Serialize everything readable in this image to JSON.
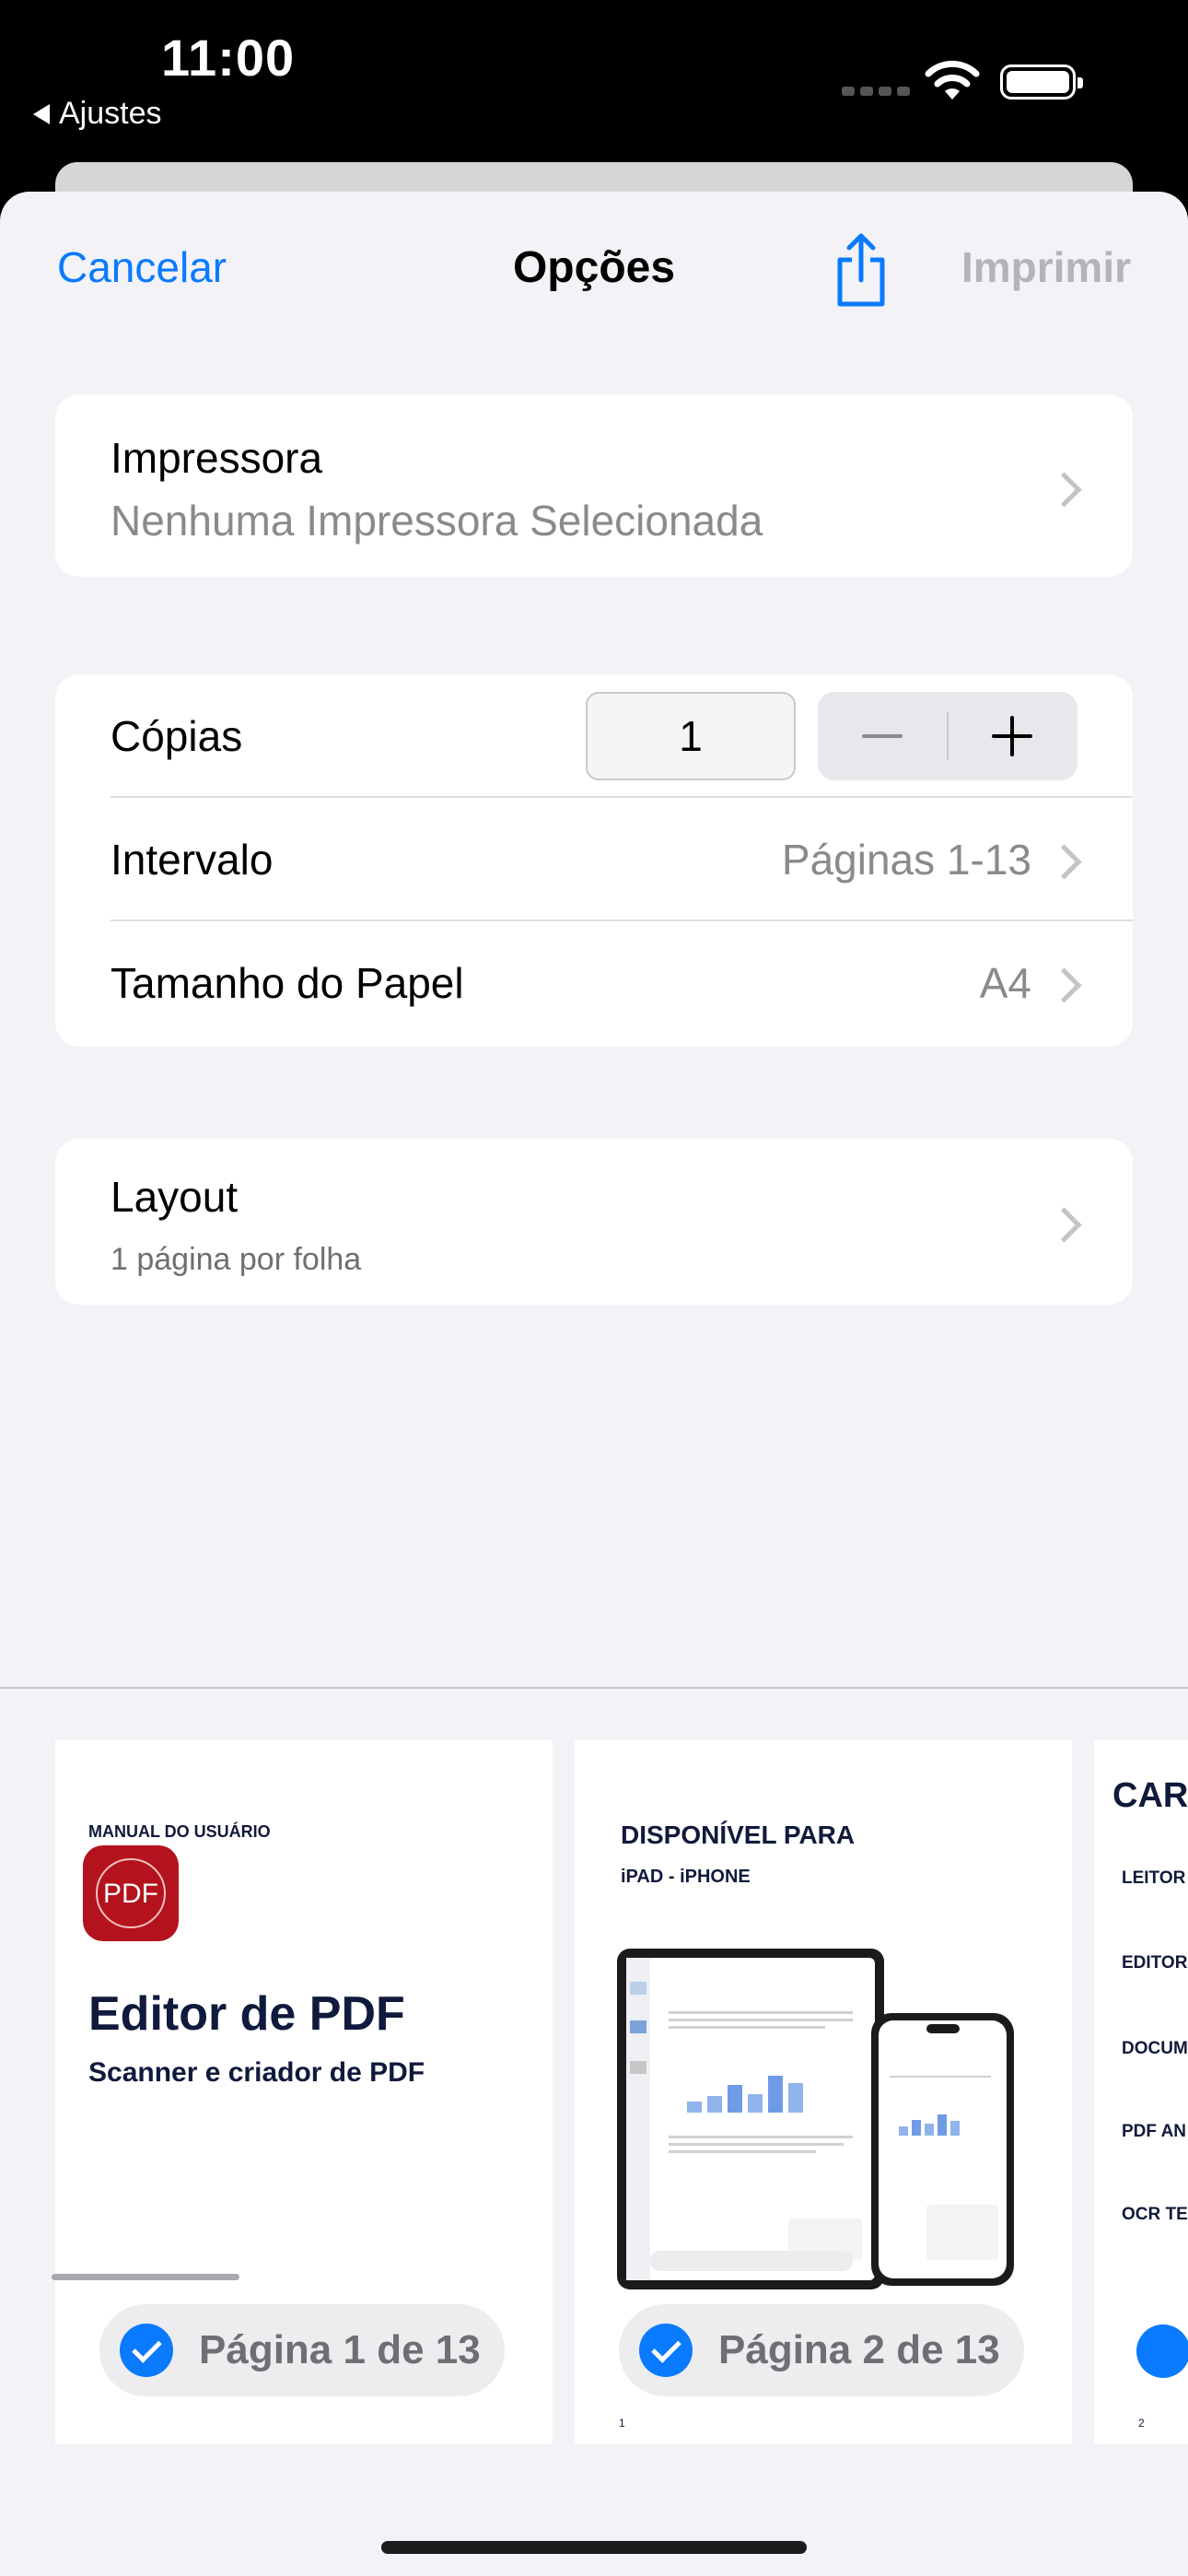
{
  "status_bar": {
    "time": "11:00",
    "back_app": "Ajustes"
  },
  "nav": {
    "cancel": "Cancelar",
    "title": "Opções",
    "print": "Imprimir"
  },
  "printer": {
    "label": "Impressora",
    "value": "Nenhuma Impressora Selecionada"
  },
  "options": {
    "copies": {
      "label": "Cópias",
      "value": "1"
    },
    "range": {
      "label": "Intervalo",
      "value": "Páginas 1-13"
    },
    "paper": {
      "label": "Tamanho do Papel",
      "value": "A4"
    }
  },
  "layout": {
    "label": "Layout",
    "value": "1 página por folha"
  },
  "pages": [
    {
      "pill": "Página 1 de 13",
      "kicker": "MANUAL DO USUÁRIO",
      "icon_text": "PDF",
      "title": "Editor de PDF",
      "subtitle": "Scanner e criador de PDF"
    },
    {
      "pill": "Página 2 de 13",
      "title": "DISPONÍVEL PARA",
      "subtitle": "iPAD - iPHONE",
      "page_number": "1"
    },
    {
      "title": "CAR",
      "items": [
        "LEITOR",
        "EDITOR",
        "DOCUM",
        "PDF AN",
        "OCR TE"
      ],
      "page_number": "2"
    }
  ],
  "colors": {
    "accent": "#0a7aff",
    "sheet_bg": "#f2f2f7",
    "icon_red": "#b4131d",
    "navy": "#0f1a3c"
  }
}
